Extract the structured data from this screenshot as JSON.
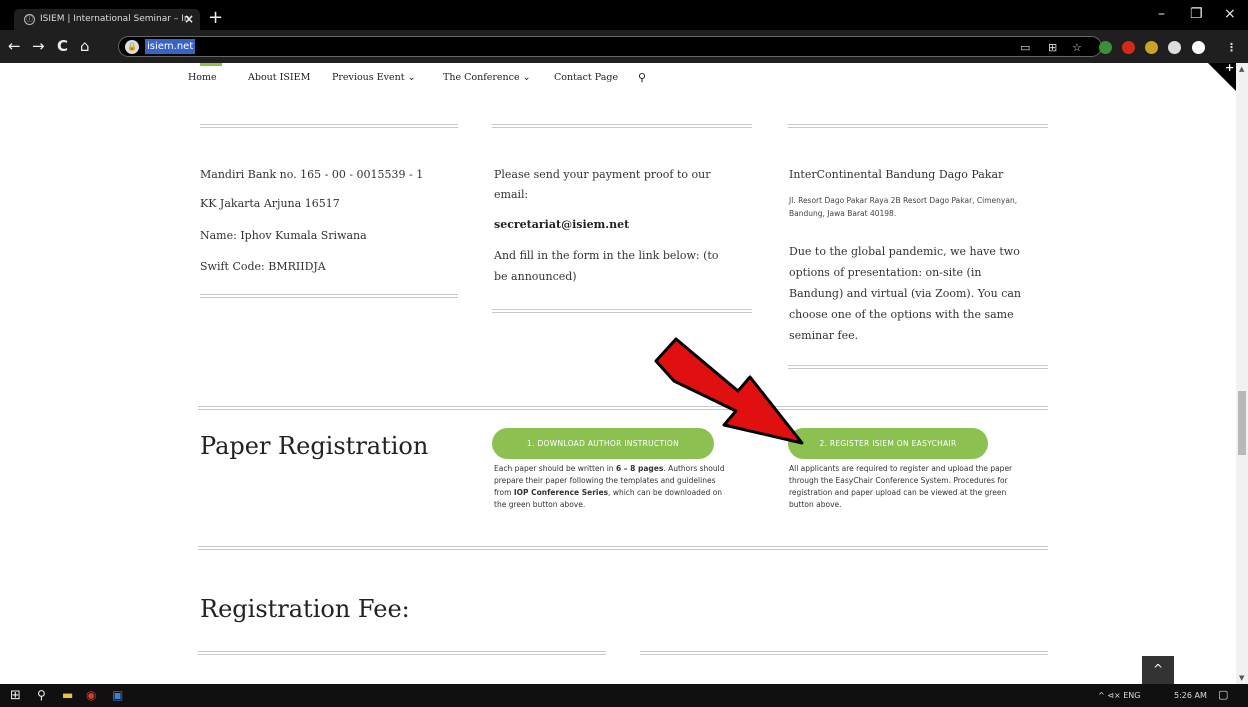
{
  "browser": {
    "tab_title": "ISIEM | International Seminar – In",
    "tab_icon": "ⓘ",
    "tab_close": "×",
    "new_tab": "+",
    "url": "isiem.net",
    "win_min": "–",
    "win_max": "❐",
    "win_close": "×",
    "back": "←",
    "forward": "→",
    "reload": "C",
    "home": "⌂",
    "menu": "⋮"
  },
  "site_nav": {
    "items": [
      "Home",
      "About ISIEM",
      "Previous Event ⌄",
      "The Conference ⌄",
      "Contact Page"
    ],
    "search": "🔍"
  },
  "payment": {
    "bank_line": "Mandiri Bank no. 165 - 00 - 0015539 - 1",
    "branch": "KK Jakarta Arjuna 16517",
    "name": "Name: Iphov Kumala Sriwana",
    "swift": "Swift Code: BMRIIDJA"
  },
  "proof": {
    "line1": "Please send your payment proof to our",
    "line2": "email:",
    "email": "secretariat@isiem.net",
    "fill1": "And fill in the form in the link below: (to",
    "fill2": "be announced)"
  },
  "venue": {
    "name": "InterContinental Bandung Dago Pakar",
    "addr1": "Jl. Resort Dago Pakar Raya 2B Resort Dago Pakar, Cimenyan,",
    "addr2": "Bandung, Jawa Barat 40198.",
    "p1": "Due to the global pandemic, we have two",
    "p2": "options of presentation: on-site (in",
    "p3": "Bandung) and virtual (via Zoom). You can",
    "p4": "choose one of the options with the same",
    "p5": "seminar fee."
  },
  "paper_reg": {
    "title": "Paper Registration",
    "btn1": "1. DOWNLOAD AUTHOR INSTRUCTION",
    "btn2": "2. REGISTER ISIEM ON EASYCHAIR",
    "d1_a": "Each paper should be written in ",
    "d1_b": "6 – 8 pages",
    "d1_c": ". Authors should",
    "d1_l2": "prepare their paper following the templates and guidelines",
    "d1_l3a": "from ",
    "d1_l3b": "IOP Conference Series",
    "d1_l3c": ", which can be downloaded on",
    "d1_l4": "the green button above.",
    "d2_l1": "All applicants are required to register and upload the paper",
    "d2_l2": "through the EasyChair Conference System. Procedures for",
    "d2_l3": "registration and paper upload can be viewed at the green",
    "d2_l4": "button above."
  },
  "reg_fee": {
    "title": "Registration Fee:"
  },
  "back_to_top": "^",
  "taskbar": {
    "tray_text": "^ ⊲× ENG",
    "time": "5:26 AM"
  },
  "colors": {
    "accent_green": "#8cc152",
    "arrow_red": "#e01010"
  }
}
